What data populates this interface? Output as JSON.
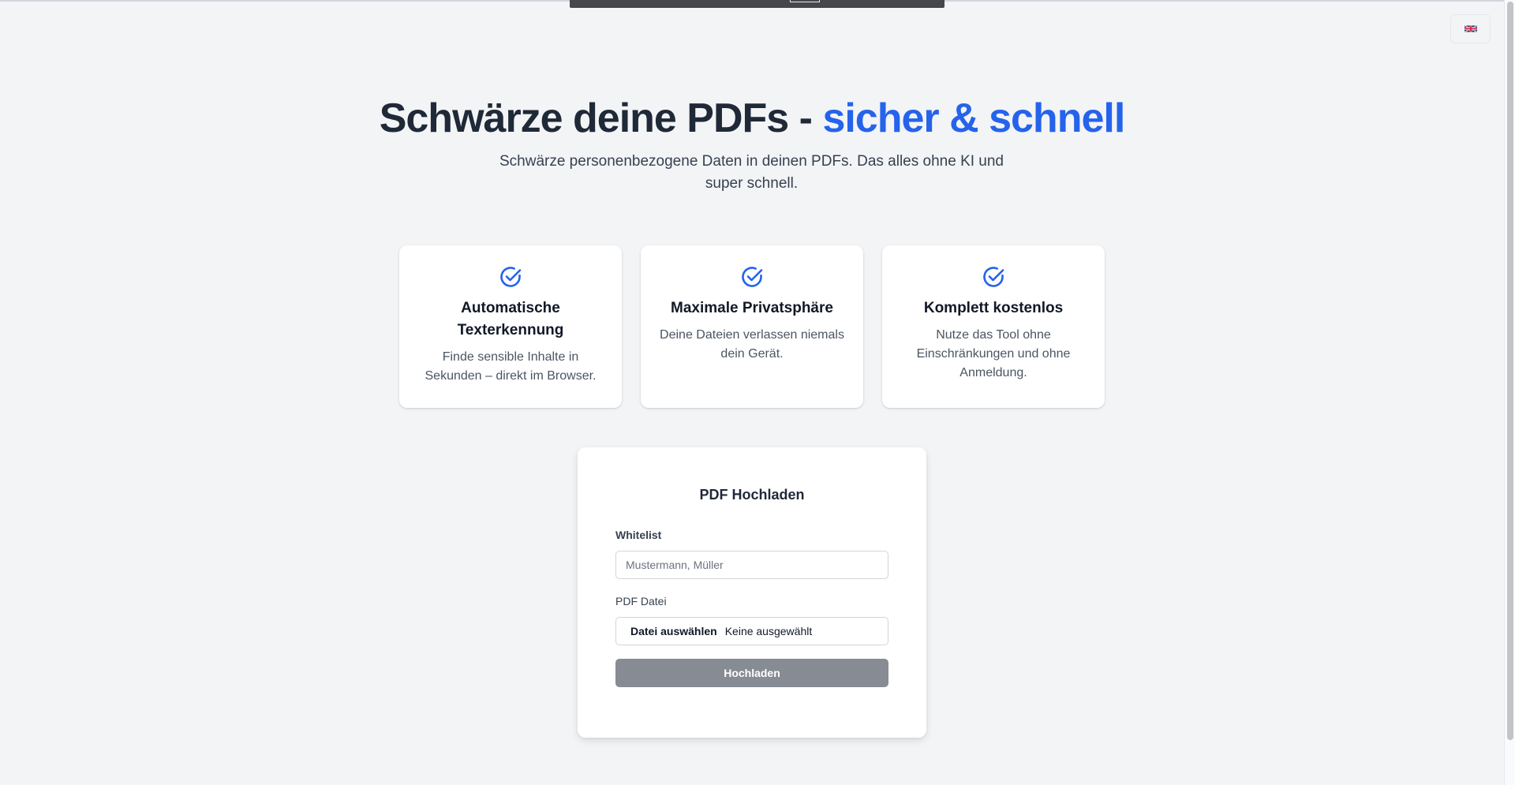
{
  "language_switcher": {
    "flag": "uk-flag-icon"
  },
  "hero": {
    "title_main": "Schwärze deine PDFs - ",
    "title_accent": "sicher & schnell",
    "subtitle": "Schwärze personenbezogene Daten in deinen PDFs. Das alles ohne KI und super schnell."
  },
  "features": [
    {
      "icon": "check-circle-icon",
      "title": "Automatische Texterkennung",
      "description": "Finde sensible Inhalte in Sekunden – direkt im Browser."
    },
    {
      "icon": "check-circle-icon",
      "title": "Maximale Privatsphäre",
      "description": "Deine Dateien verlassen niemals dein Gerät."
    },
    {
      "icon": "check-circle-icon",
      "title": "Komplett kostenlos",
      "description": "Nutze das Tool ohne Einschränkungen und ohne Anmeldung."
    }
  ],
  "upload": {
    "title": "PDF Hochladen",
    "whitelist_label": "Whitelist",
    "whitelist_placeholder": "Mustermann, Müller",
    "whitelist_value": "",
    "file_label": "PDF Datei",
    "file_button": "Datei auswählen",
    "file_status": "Keine ausgewählt",
    "submit_label": "Hochladen"
  },
  "colors": {
    "accent": "#2563eb",
    "background": "#f3f4f6",
    "button_disabled": "#878b93"
  }
}
